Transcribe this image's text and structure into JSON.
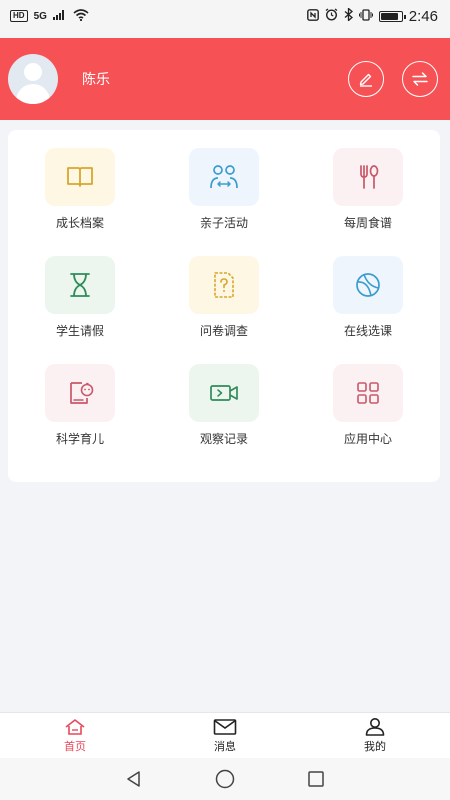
{
  "status_bar": {
    "hd": "HD",
    "network": "5G",
    "time": "2:46",
    "battery_level": 0.85
  },
  "header": {
    "user_name": "陈乐"
  },
  "grid": [
    {
      "label": "成长档案",
      "icon": "book-icon",
      "bg": "#fdf7e4",
      "color": "#d9a62e"
    },
    {
      "label": "亲子活动",
      "icon": "parent-child-icon",
      "bg": "#eef5fc",
      "color": "#3a9ccf"
    },
    {
      "label": "每周食谱",
      "icon": "fork-spoon-icon",
      "bg": "#fbf1f3",
      "color": "#c9586a"
    },
    {
      "label": "学生请假",
      "icon": "hourglass-icon",
      "bg": "#ecf6ef",
      "color": "#2f8c5a"
    },
    {
      "label": "问卷调查",
      "icon": "question-doc-icon",
      "bg": "#fdf7e4",
      "color": "#d9a62e"
    },
    {
      "label": "在线选课",
      "icon": "ball-icon",
      "bg": "#eef5fc",
      "color": "#3a9ccf"
    },
    {
      "label": "科学育儿",
      "icon": "baby-book-icon",
      "bg": "#fbf1f3",
      "color": "#c9586a"
    },
    {
      "label": "观察记录",
      "icon": "video-icon",
      "bg": "#ecf6ef",
      "color": "#2f8c5a"
    },
    {
      "label": "应用中心",
      "icon": "apps-grid-icon",
      "bg": "#fbf1f3",
      "color": "#c9586a"
    }
  ],
  "bottom_nav": [
    {
      "label": "首页",
      "icon": "home-icon",
      "active": true
    },
    {
      "label": "消息",
      "icon": "mail-icon",
      "active": false
    },
    {
      "label": "我的",
      "icon": "user-icon",
      "active": false
    }
  ],
  "colors": {
    "header_bg": "#f65256",
    "accent": "#e8485a",
    "page_bg": "#f3f4f8"
  }
}
